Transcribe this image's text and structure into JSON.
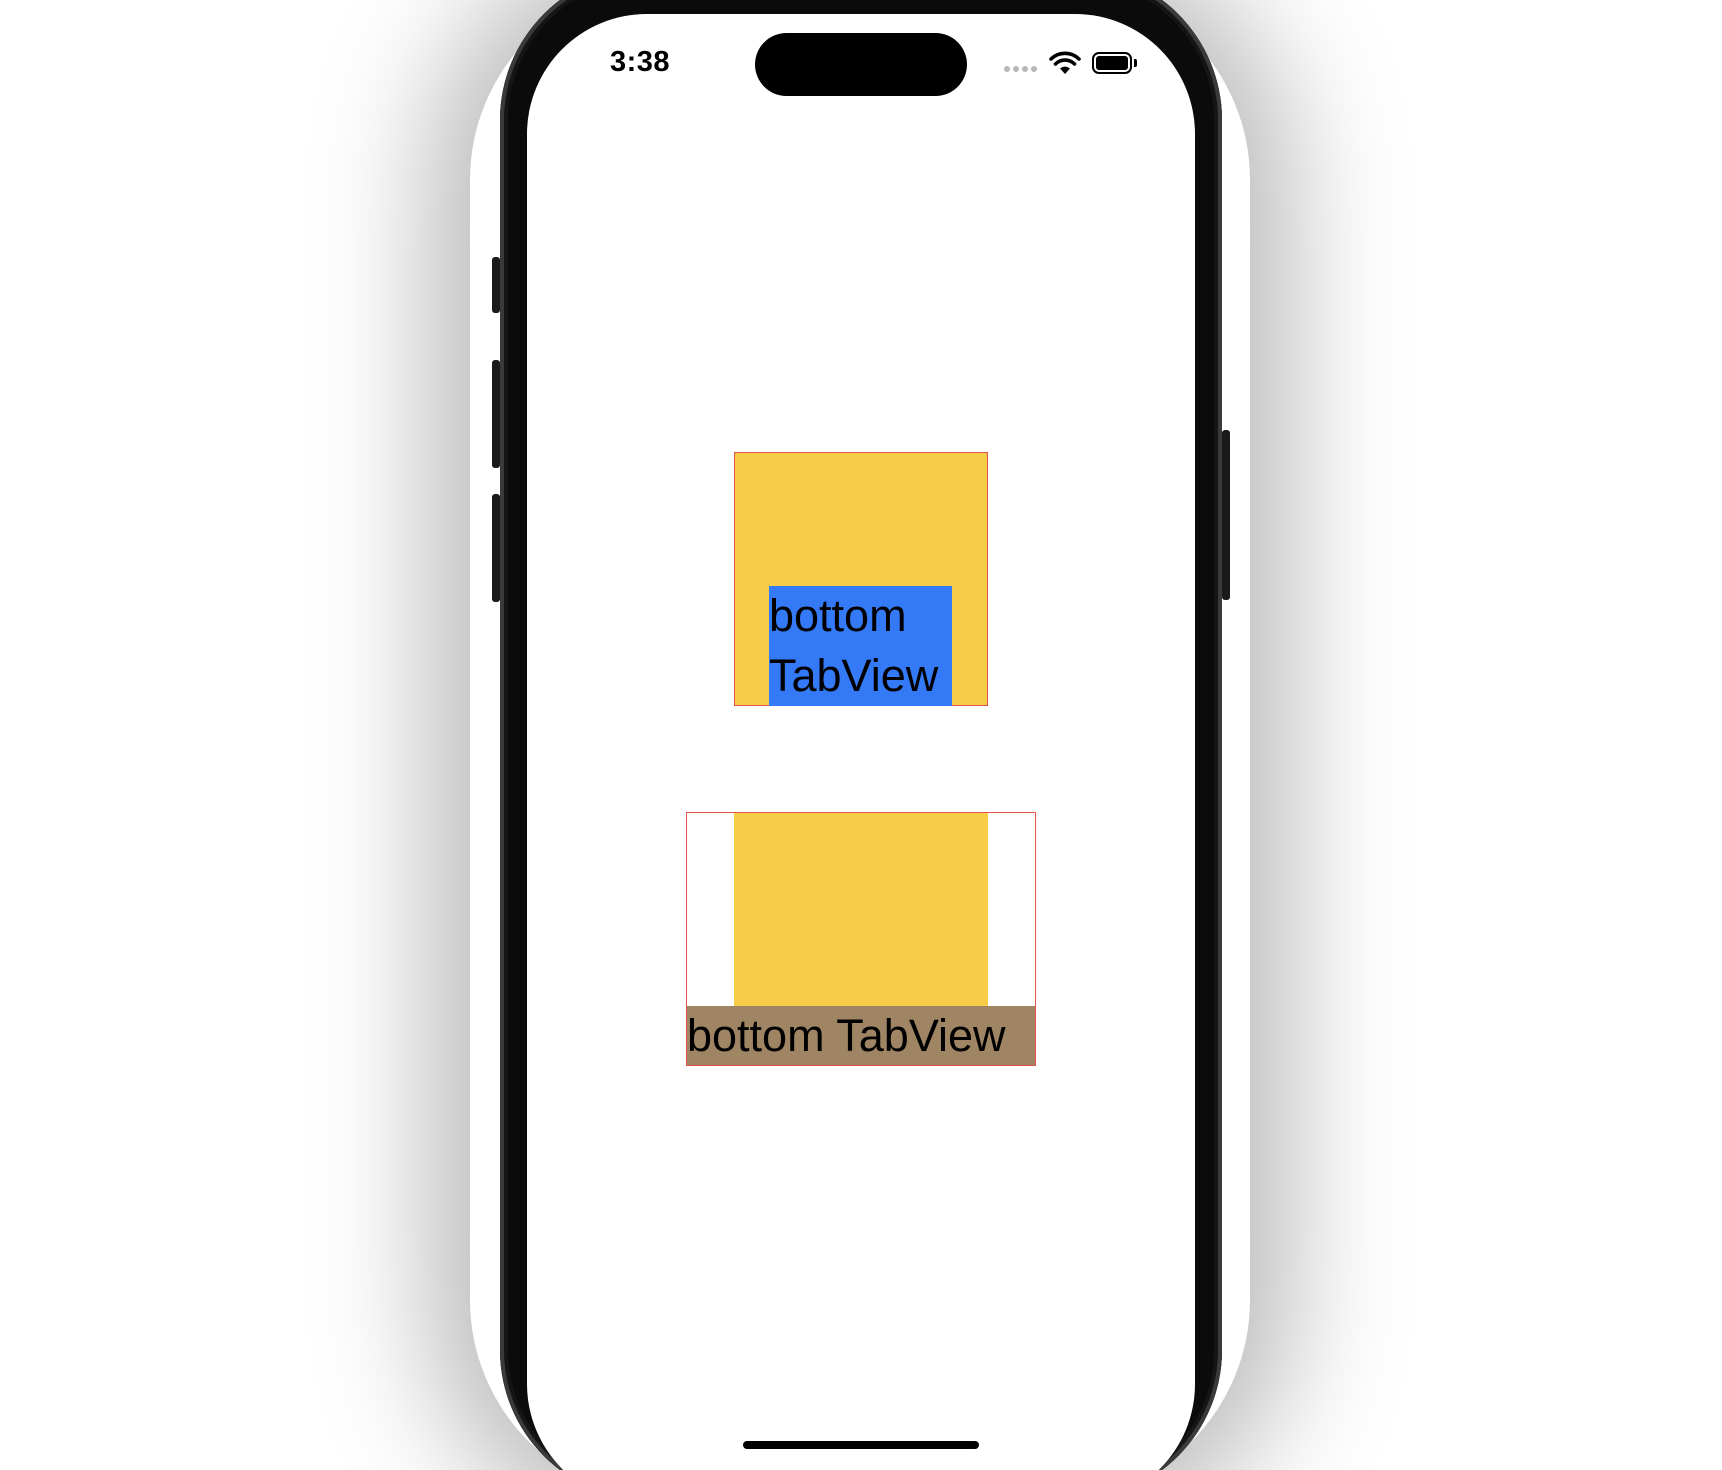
{
  "status_bar": {
    "time": "3:38"
  },
  "demo_top": {
    "label": "bottom TabView",
    "container_color": "#f7cd48",
    "label_background": "#3479f6",
    "border_color": "#e4534b"
  },
  "demo_bottom": {
    "label": "bottom TabView",
    "container_color": "#f7cd48",
    "label_background": "#9f8563",
    "border_color": "#e4534b"
  }
}
